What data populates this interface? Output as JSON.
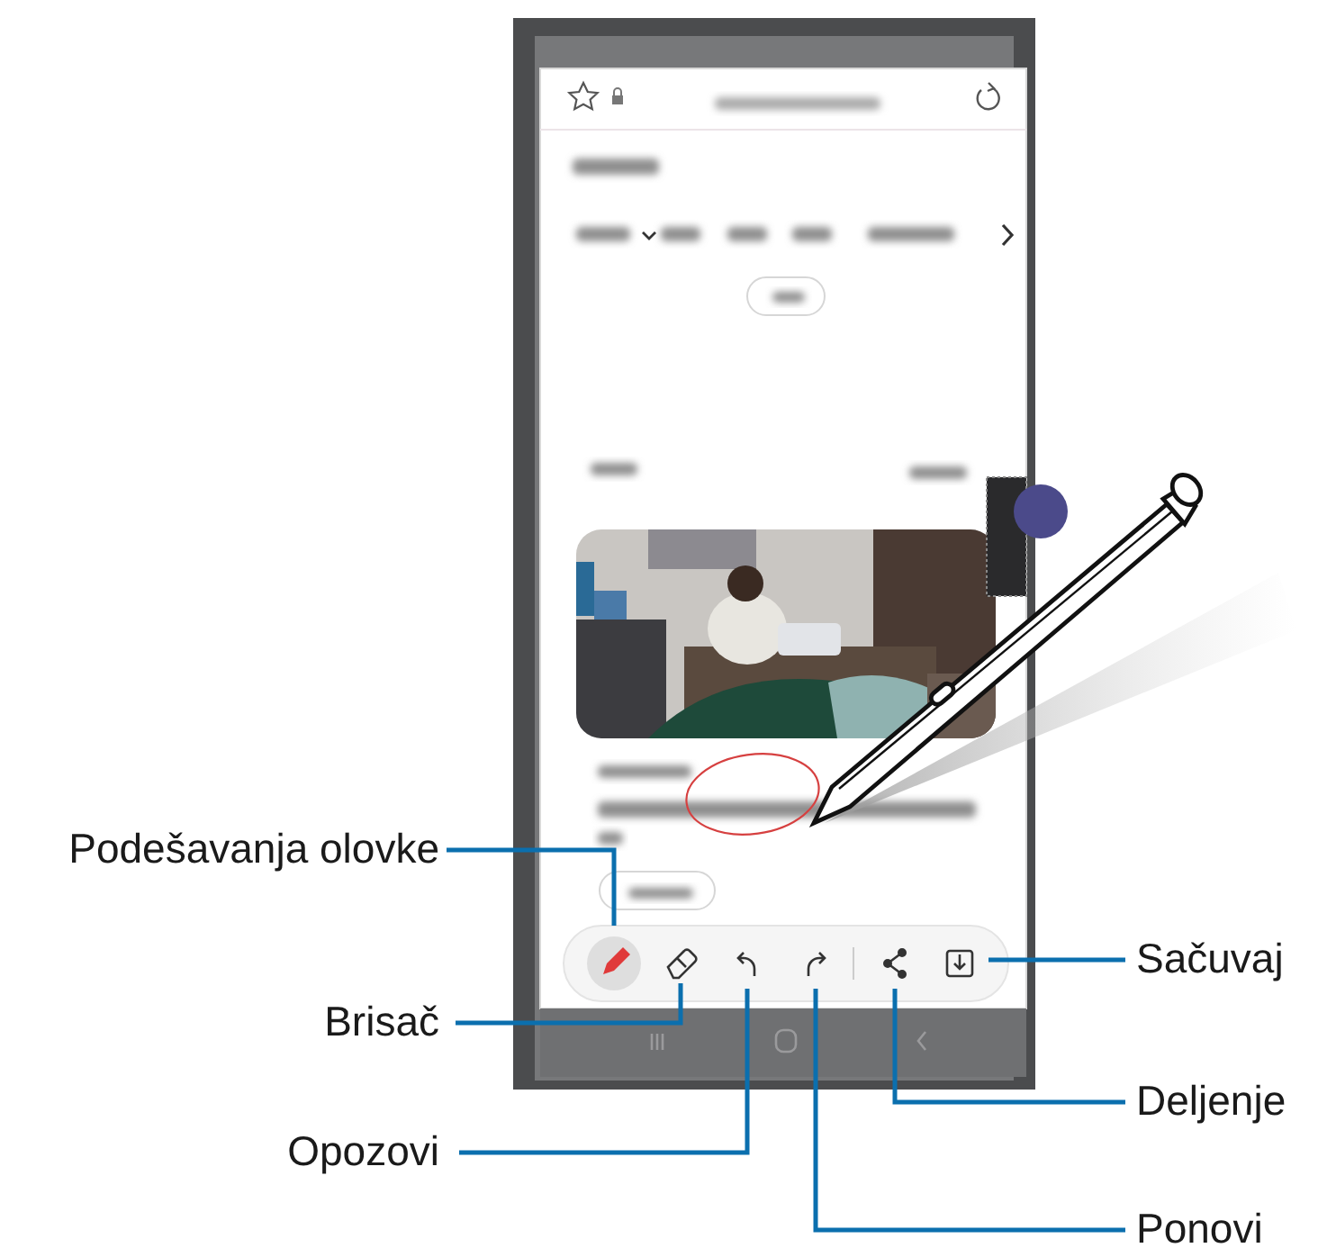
{
  "toolbar": [
    {
      "kind": "pen",
      "selected": true
    },
    {
      "kind": "eraser",
      "selected": false
    },
    {
      "kind": "undo",
      "selected": false
    },
    {
      "kind": "redo",
      "selected": false
    },
    {
      "kind": "share",
      "selected": false
    },
    {
      "kind": "save",
      "selected": false
    }
  ],
  "callouts": [
    {
      "label": "Podešavanja olovke"
    },
    {
      "label": "Sačuvaj"
    },
    {
      "label": "Brisač"
    },
    {
      "label": "Deljenje"
    },
    {
      "label": "Opozovi"
    },
    {
      "label": "Ponovi"
    }
  ]
}
